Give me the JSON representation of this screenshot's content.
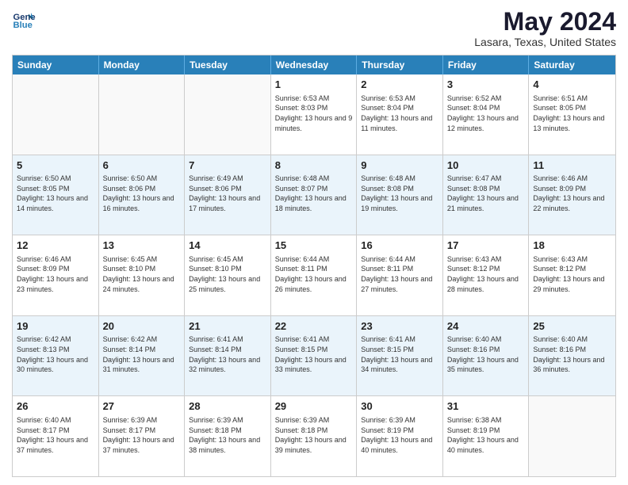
{
  "header": {
    "logo_line1": "General",
    "logo_line2": "Blue",
    "month_title": "May 2024",
    "location": "Lasara, Texas, United States"
  },
  "weekdays": [
    "Sunday",
    "Monday",
    "Tuesday",
    "Wednesday",
    "Thursday",
    "Friday",
    "Saturday"
  ],
  "rows": [
    [
      {
        "day": "",
        "info": ""
      },
      {
        "day": "",
        "info": ""
      },
      {
        "day": "",
        "info": ""
      },
      {
        "day": "1",
        "info": "Sunrise: 6:53 AM\nSunset: 8:03 PM\nDaylight: 13 hours and 9 minutes."
      },
      {
        "day": "2",
        "info": "Sunrise: 6:53 AM\nSunset: 8:04 PM\nDaylight: 13 hours and 11 minutes."
      },
      {
        "day": "3",
        "info": "Sunrise: 6:52 AM\nSunset: 8:04 PM\nDaylight: 13 hours and 12 minutes."
      },
      {
        "day": "4",
        "info": "Sunrise: 6:51 AM\nSunset: 8:05 PM\nDaylight: 13 hours and 13 minutes."
      }
    ],
    [
      {
        "day": "5",
        "info": "Sunrise: 6:50 AM\nSunset: 8:05 PM\nDaylight: 13 hours and 14 minutes."
      },
      {
        "day": "6",
        "info": "Sunrise: 6:50 AM\nSunset: 8:06 PM\nDaylight: 13 hours and 16 minutes."
      },
      {
        "day": "7",
        "info": "Sunrise: 6:49 AM\nSunset: 8:06 PM\nDaylight: 13 hours and 17 minutes."
      },
      {
        "day": "8",
        "info": "Sunrise: 6:48 AM\nSunset: 8:07 PM\nDaylight: 13 hours and 18 minutes."
      },
      {
        "day": "9",
        "info": "Sunrise: 6:48 AM\nSunset: 8:08 PM\nDaylight: 13 hours and 19 minutes."
      },
      {
        "day": "10",
        "info": "Sunrise: 6:47 AM\nSunset: 8:08 PM\nDaylight: 13 hours and 21 minutes."
      },
      {
        "day": "11",
        "info": "Sunrise: 6:46 AM\nSunset: 8:09 PM\nDaylight: 13 hours and 22 minutes."
      }
    ],
    [
      {
        "day": "12",
        "info": "Sunrise: 6:46 AM\nSunset: 8:09 PM\nDaylight: 13 hours and 23 minutes."
      },
      {
        "day": "13",
        "info": "Sunrise: 6:45 AM\nSunset: 8:10 PM\nDaylight: 13 hours and 24 minutes."
      },
      {
        "day": "14",
        "info": "Sunrise: 6:45 AM\nSunset: 8:10 PM\nDaylight: 13 hours and 25 minutes."
      },
      {
        "day": "15",
        "info": "Sunrise: 6:44 AM\nSunset: 8:11 PM\nDaylight: 13 hours and 26 minutes."
      },
      {
        "day": "16",
        "info": "Sunrise: 6:44 AM\nSunset: 8:11 PM\nDaylight: 13 hours and 27 minutes."
      },
      {
        "day": "17",
        "info": "Sunrise: 6:43 AM\nSunset: 8:12 PM\nDaylight: 13 hours and 28 minutes."
      },
      {
        "day": "18",
        "info": "Sunrise: 6:43 AM\nSunset: 8:12 PM\nDaylight: 13 hours and 29 minutes."
      }
    ],
    [
      {
        "day": "19",
        "info": "Sunrise: 6:42 AM\nSunset: 8:13 PM\nDaylight: 13 hours and 30 minutes."
      },
      {
        "day": "20",
        "info": "Sunrise: 6:42 AM\nSunset: 8:14 PM\nDaylight: 13 hours and 31 minutes."
      },
      {
        "day": "21",
        "info": "Sunrise: 6:41 AM\nSunset: 8:14 PM\nDaylight: 13 hours and 32 minutes."
      },
      {
        "day": "22",
        "info": "Sunrise: 6:41 AM\nSunset: 8:15 PM\nDaylight: 13 hours and 33 minutes."
      },
      {
        "day": "23",
        "info": "Sunrise: 6:41 AM\nSunset: 8:15 PM\nDaylight: 13 hours and 34 minutes."
      },
      {
        "day": "24",
        "info": "Sunrise: 6:40 AM\nSunset: 8:16 PM\nDaylight: 13 hours and 35 minutes."
      },
      {
        "day": "25",
        "info": "Sunrise: 6:40 AM\nSunset: 8:16 PM\nDaylight: 13 hours and 36 minutes."
      }
    ],
    [
      {
        "day": "26",
        "info": "Sunrise: 6:40 AM\nSunset: 8:17 PM\nDaylight: 13 hours and 37 minutes."
      },
      {
        "day": "27",
        "info": "Sunrise: 6:39 AM\nSunset: 8:17 PM\nDaylight: 13 hours and 37 minutes."
      },
      {
        "day": "28",
        "info": "Sunrise: 6:39 AM\nSunset: 8:18 PM\nDaylight: 13 hours and 38 minutes."
      },
      {
        "day": "29",
        "info": "Sunrise: 6:39 AM\nSunset: 8:18 PM\nDaylight: 13 hours and 39 minutes."
      },
      {
        "day": "30",
        "info": "Sunrise: 6:39 AM\nSunset: 8:19 PM\nDaylight: 13 hours and 40 minutes."
      },
      {
        "day": "31",
        "info": "Sunrise: 6:38 AM\nSunset: 8:19 PM\nDaylight: 13 hours and 40 minutes."
      },
      {
        "day": "",
        "info": ""
      }
    ]
  ],
  "alt_rows": [
    1,
    3
  ]
}
